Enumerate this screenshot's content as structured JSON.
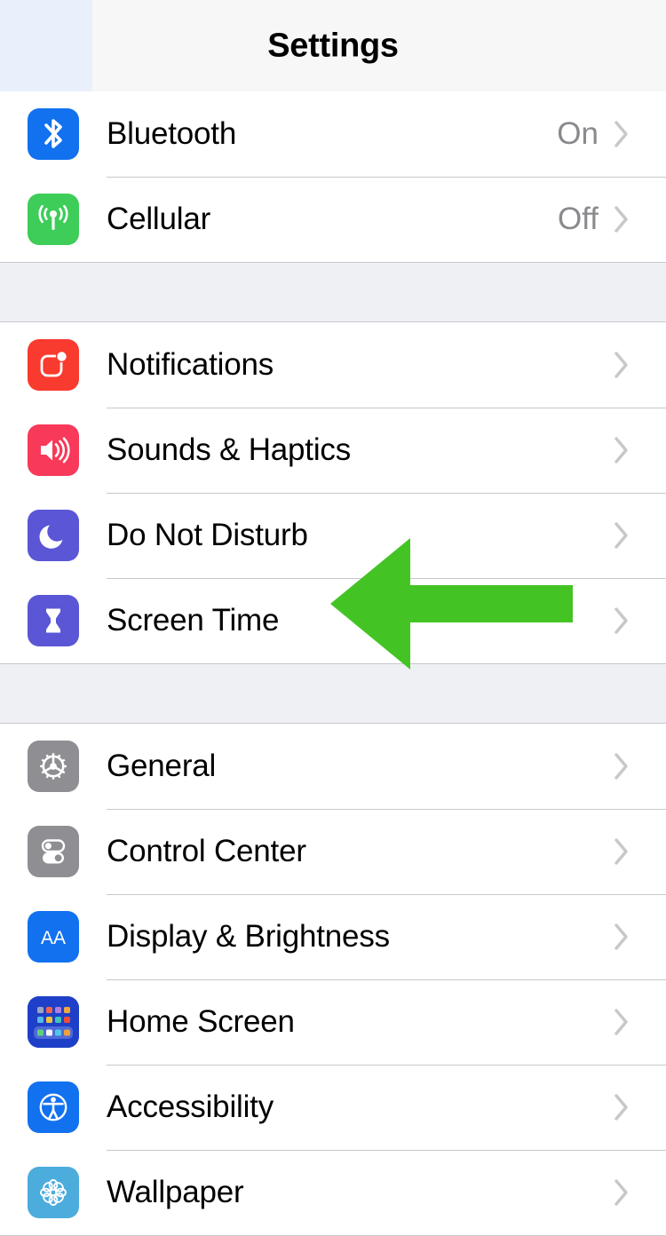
{
  "header": {
    "title": "Settings"
  },
  "colors": {
    "arrow": "#44c424",
    "separator": "#c8c7cc",
    "group_gap": "#eff0f4",
    "value_text": "#8a8a8e",
    "chevron": "#c7c7cc",
    "bluetooth": "#1271ef",
    "cellular": "#3dcd58",
    "notifications": "#f93a2f",
    "sounds": "#f8395a",
    "do_not_disturb": "#5a56d6",
    "screen_time": "#5a56d6",
    "general": "#8e8e93",
    "control_center": "#8e8e93",
    "display_brightness": "#1271ef",
    "home_screen": "#1e40c8",
    "accessibility": "#1271ef",
    "wallpaper": "#4cacdc"
  },
  "groups": [
    {
      "id": "connectivity",
      "rows": [
        {
          "label": "Bluetooth",
          "value": "On",
          "icon": "bluetooth-icon",
          "chevron": "chevron-right-icon"
        },
        {
          "label": "Cellular",
          "value": "Off",
          "icon": "cellular-icon",
          "chevron": "chevron-right-icon"
        }
      ]
    },
    {
      "id": "alerts",
      "rows": [
        {
          "label": "Notifications",
          "value": "",
          "icon": "notifications-icon",
          "chevron": "chevron-right-icon"
        },
        {
          "label": "Sounds & Haptics",
          "value": "",
          "icon": "sounds-haptics-icon",
          "chevron": "chevron-right-icon"
        },
        {
          "label": "Do Not Disturb",
          "value": "",
          "icon": "do-not-disturb-icon",
          "chevron": "chevron-right-icon"
        },
        {
          "label": "Screen Time",
          "value": "",
          "icon": "screen-time-icon",
          "chevron": "chevron-right-icon"
        }
      ]
    },
    {
      "id": "system",
      "rows": [
        {
          "label": "General",
          "value": "",
          "icon": "general-gear-icon",
          "chevron": "chevron-right-icon"
        },
        {
          "label": "Control Center",
          "value": "",
          "icon": "control-center-icon",
          "chevron": "chevron-right-icon"
        },
        {
          "label": "Display & Brightness",
          "value": "",
          "icon": "display-brightness-icon",
          "chevron": "chevron-right-icon"
        },
        {
          "label": "Home Screen",
          "value": "",
          "icon": "home-screen-icon",
          "chevron": "chevron-right-icon"
        },
        {
          "label": "Accessibility",
          "value": "",
          "icon": "accessibility-icon",
          "chevron": "chevron-right-icon"
        },
        {
          "label": "Wallpaper",
          "value": "",
          "icon": "wallpaper-icon",
          "chevron": "chevron-right-icon"
        }
      ]
    }
  ],
  "annotation": {
    "type": "arrow",
    "direction": "left",
    "points_to": "Screen Time"
  }
}
